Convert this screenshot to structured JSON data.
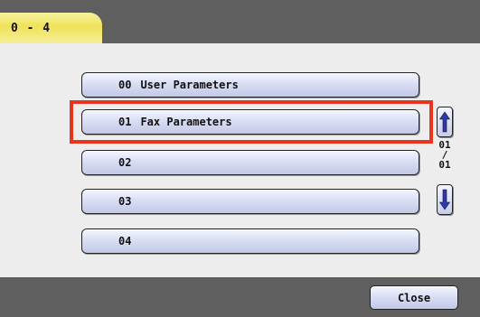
{
  "header": {
    "tab_label": "0 - 4"
  },
  "parameters": [
    {
      "number": "00",
      "label": "User Parameters"
    },
    {
      "number": "01",
      "label": "Fax Parameters"
    },
    {
      "number": "02",
      "label": ""
    },
    {
      "number": "03",
      "label": ""
    },
    {
      "number": "04",
      "label": ""
    }
  ],
  "highlighted_item": "01",
  "highlight_color": "#e8351e",
  "pager": {
    "current": "01",
    "separator": "/",
    "total": "01",
    "up_icon": "arrow-up-icon",
    "down_icon": "arrow-down-icon"
  },
  "footer": {
    "close_label": "Close"
  }
}
